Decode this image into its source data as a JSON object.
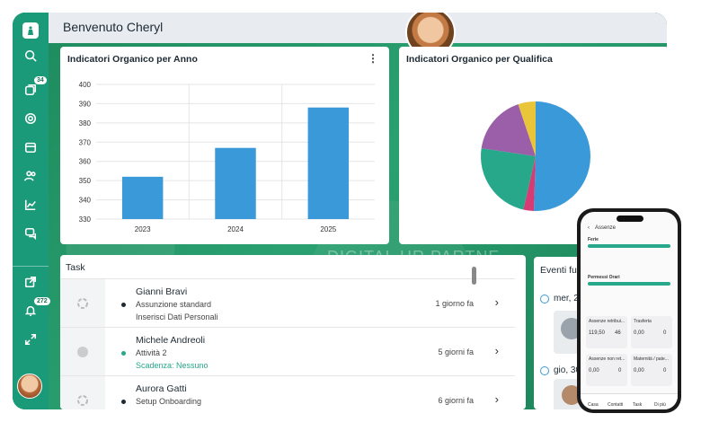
{
  "header": {
    "greeting": "Benvenuto Cheryl"
  },
  "sidebar": {
    "badges": {
      "inbox": "34",
      "notifications": "272"
    }
  },
  "bar_chart_card": {
    "title": "Indicatori Organico per Anno",
    "menu_icon": "kebab-icon"
  },
  "pie_chart_card": {
    "title": "Indicatori Organico per Qualifica"
  },
  "chart_data": [
    {
      "type": "bar",
      "title": "Indicatori Organico per Anno",
      "categories": [
        "2023",
        "2024",
        "2025"
      ],
      "values": [
        352,
        367,
        388
      ],
      "ylim": [
        330,
        400
      ],
      "yticks": [
        330,
        340,
        350,
        360,
        370,
        380,
        390,
        400
      ],
      "color": "#3a9ad9",
      "grid": true
    },
    {
      "type": "pie",
      "title": "Indicatori Organico per Qualifica",
      "values": [
        49,
        3,
        23,
        17,
        5
      ],
      "colors": [
        "#3a9ad9",
        "#d63b73",
        "#27a88a",
        "#9a5fa8",
        "#e9c53a"
      ]
    }
  ],
  "task_card": {
    "title": "Task",
    "rows": [
      {
        "name": "Gianni Bravi",
        "line1": "Assunzione standard",
        "line2": "Inserisci Dati Personali",
        "time": "1 giorno fa",
        "dot_color": "#1d2a33",
        "status_icon": "progress-ring-icon"
      },
      {
        "name": "Michele Andreoli",
        "line1": "Attività 2",
        "line2": "Scadenza: Nessuno",
        "time": "5 giorni fa",
        "dot_color": "#27a88a",
        "status_icon": "grey-circle-icon"
      },
      {
        "name": "Aurora Gatti",
        "line1": "Setup Onboarding",
        "line2": "",
        "time": "6 giorni fa",
        "dot_color": "#1d2a33",
        "status_icon": "progress-ring-icon"
      }
    ]
  },
  "events_card": {
    "title": "Eventi fu",
    "items": [
      {
        "date": "mer, 2"
      },
      {
        "date": "gio, 30"
      }
    ]
  },
  "watermark": "DIGITAL HR PARTNE",
  "phone": {
    "title": "Assenze",
    "section1": "Ferie",
    "section2": "Permessi Orari",
    "cards": [
      {
        "title": "Assenze retribui...",
        "v1": "119,50",
        "v2": "46"
      },
      {
        "title": "Trasferta",
        "v1": "0,00",
        "v2": "0"
      },
      {
        "title": "Assenze non ret...",
        "v1": "0,00",
        "v2": "0"
      },
      {
        "title": "Maternità / pate...",
        "v1": "0,00",
        "v2": "0"
      }
    ],
    "nav": [
      "Casa",
      "Contatti",
      "Task",
      "Di più"
    ]
  }
}
